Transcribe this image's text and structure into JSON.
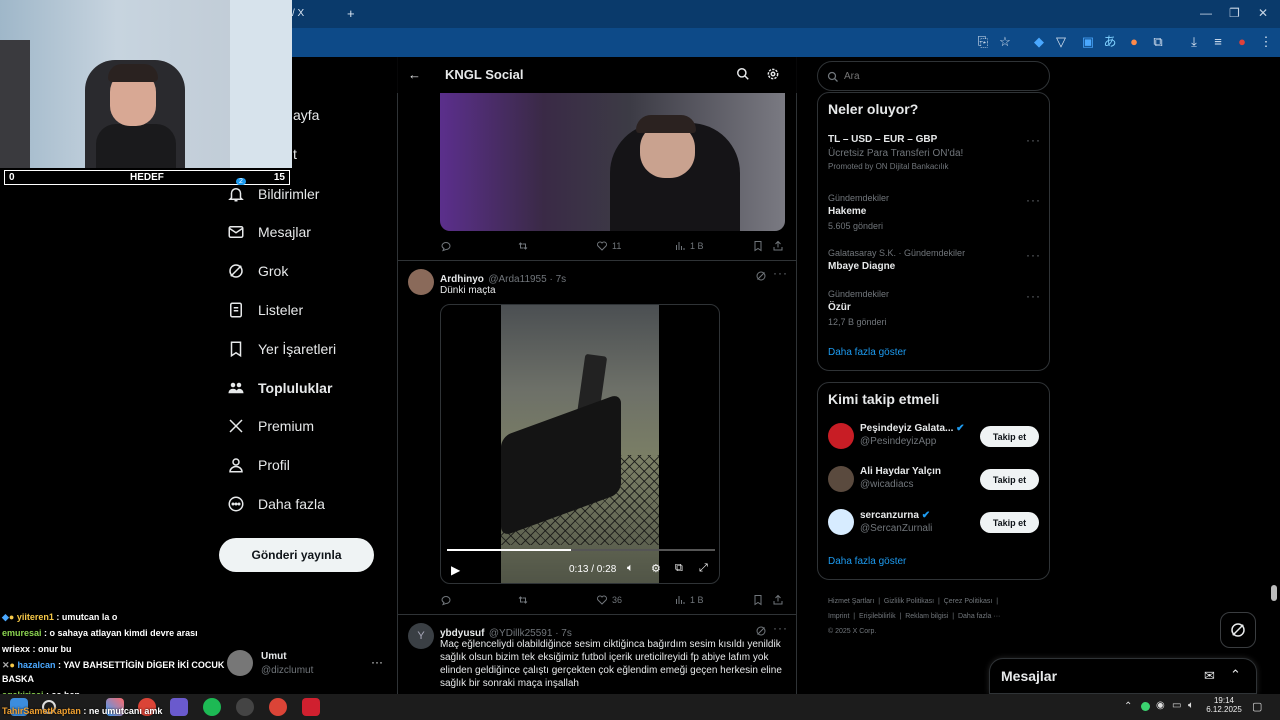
{
  "browser": {
    "tab_label": "/ X",
    "new_tab": "+"
  },
  "stream": {
    "goal_left": "0",
    "goal_label": "HEDEF",
    "goal_right": "15"
  },
  "nav": {
    "partial_home": "ayfa",
    "partial_explore": "t",
    "notifications": "Bildirimler",
    "notification_badge": "2",
    "messages": "Mesajlar",
    "grok": "Grok",
    "lists": "Listeler",
    "bookmarks": "Yer İşaretleri",
    "communities": "Topluluklar",
    "premium": "Premium",
    "profile": "Profil",
    "more": "Daha fazla",
    "post_button": "Gönderi yayınla"
  },
  "account": {
    "name": "Umut",
    "handle": "@dizclumut"
  },
  "header": {
    "title": "KNGL Social"
  },
  "tweet1": {
    "likes": "11",
    "views": "1 B"
  },
  "tweet2": {
    "name": "Ardhinyo",
    "handle": "@Arda11955 · 7s",
    "text": "Dünki maçta",
    "time": "0:13 / 0:28",
    "likes": "36",
    "views": "1 B"
  },
  "tweet3": {
    "avatar_letter": "Y",
    "name": "ybdyusuf",
    "handle": "@YDillk25591 · 7s",
    "text": "Maç eğlenceliydi olabildiğince sesim ciktiğinca bağırdım sesim kısıldı yenildik sağlık olsun bizim tek eksiğimiz futbol içerik ureticilreyidi fp abiye lafım yok elinden geldiğince çalıştı gerçekten çok eğlendim emeği geçen herkesin eline sağlık bir sonraki maça inşallah"
  },
  "search": {
    "placeholder": "Ara"
  },
  "trends": {
    "heading": "Neler oluyor?",
    "items": [
      {
        "meta": "",
        "title": "TL – USD – EUR – GBP",
        "sub": "Ücretsiz Para Transferi ON'da!",
        "extra": "Promoted by ON Dijital Bankacılık"
      },
      {
        "meta": "Gündemdekiler",
        "title": "Hakeme",
        "sub": "5.605 gönderi"
      },
      {
        "meta": "Galatasaray S.K. · Gündemdekiler",
        "title": "Mbaye Diagne",
        "sub": ""
      },
      {
        "meta": "Gündemdekiler",
        "title": "Özür",
        "sub": "12,7 B gönderi"
      }
    ],
    "show_more": "Daha fazla göster"
  },
  "who_to_follow": {
    "heading": "Kimi takip etmeli",
    "users": [
      {
        "name": "Peşindeyiz Galata...",
        "handle": "@PesindeyizApp",
        "button": "Takip et"
      },
      {
        "name": "Ali Haydar Yalçın",
        "handle": "@wicadiacs",
        "button": "Takip et"
      },
      {
        "name": "sercanzurna",
        "handle": "@SercanZurnali",
        "button": "Takip et"
      }
    ],
    "show_more": "Daha fazla göster"
  },
  "footer": {
    "links": [
      "Hizmet Şartları",
      "|",
      "Gizlilik Politikası",
      "|",
      "Çerez Politikası",
      "|"
    ],
    "links2": [
      "Imprint",
      "|",
      "Erişilebilirlik",
      "|",
      "Reklam bilgisi",
      "|",
      "Daha fazla ···"
    ],
    "copyright": "© 2025 X Corp."
  },
  "messages_dock": {
    "title": "Mesajlar"
  },
  "chat": [
    {
      "user": "yiiteren1",
      "text": ": umutcan la o",
      "color": "#f7c948"
    },
    {
      "user": "emuresai",
      "text": ": o sahaya atlayan kimdi devre arası",
      "color": "#8bd450"
    },
    {
      "user": "wriexx",
      "text": ": onur bu",
      "color": "#ffffff"
    },
    {
      "user": "hazalcan",
      "text": ": YAV BAHSETTİGİN DİGER İKİ COCUK",
      "color": "#4aa8ff"
    },
    {
      "user": "",
      "text": "BASKA",
      "color": "#ffffff"
    },
    {
      "user": "egekirisci",
      "text": ": aa ben",
      "color": "#8bd450"
    },
    {
      "user": "TahirSametKaptan",
      "text": ": ne umutcanı amk",
      "color": "#f0a030"
    }
  ],
  "taskbar": {
    "time": "19:14",
    "date": "6.12.2025"
  },
  "colors": {
    "accent": "#1d9bf0",
    "chrome": "#0d4a88"
  }
}
